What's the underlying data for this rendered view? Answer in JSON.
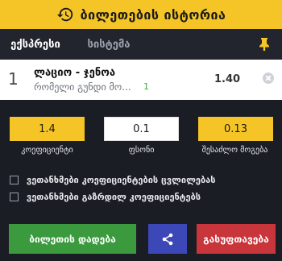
{
  "header": {
    "title": "ბილეთების ისტორია",
    "icon": "history-icon"
  },
  "tabs": [
    {
      "label": "ექსპრესი",
      "active": true
    },
    {
      "label": "სისტემა",
      "active": false
    }
  ],
  "colors": {
    "accent": "#f5c426",
    "green": "#3a9a3d",
    "blue": "#3d48b8",
    "red": "#c8353b",
    "bg": "#1b1d25"
  },
  "event": {
    "number": "1",
    "match": "ლაციო - ჯენოა",
    "pick": "რომელი გუნდი მო...",
    "pick_code": "1",
    "odd": "1.40"
  },
  "fields": {
    "coefficient": {
      "value": "1.4",
      "label": "კოეფიციენტი"
    },
    "stake": {
      "value": "0.1",
      "label": "ფსონი"
    },
    "win": {
      "value": "0.13",
      "label": "შესაძლო მოგება"
    }
  },
  "options": [
    {
      "label": "ვეთანხმები კოეფიციენტების ცვლილებას",
      "checked": false
    },
    {
      "label": "ვეთანხმები გაზრდილ კოეფიციენტებს",
      "checked": false
    }
  ],
  "buttons": {
    "place": "ბილეთის დადება",
    "share_icon": "share-icon",
    "clear": "გასუფთავება"
  }
}
